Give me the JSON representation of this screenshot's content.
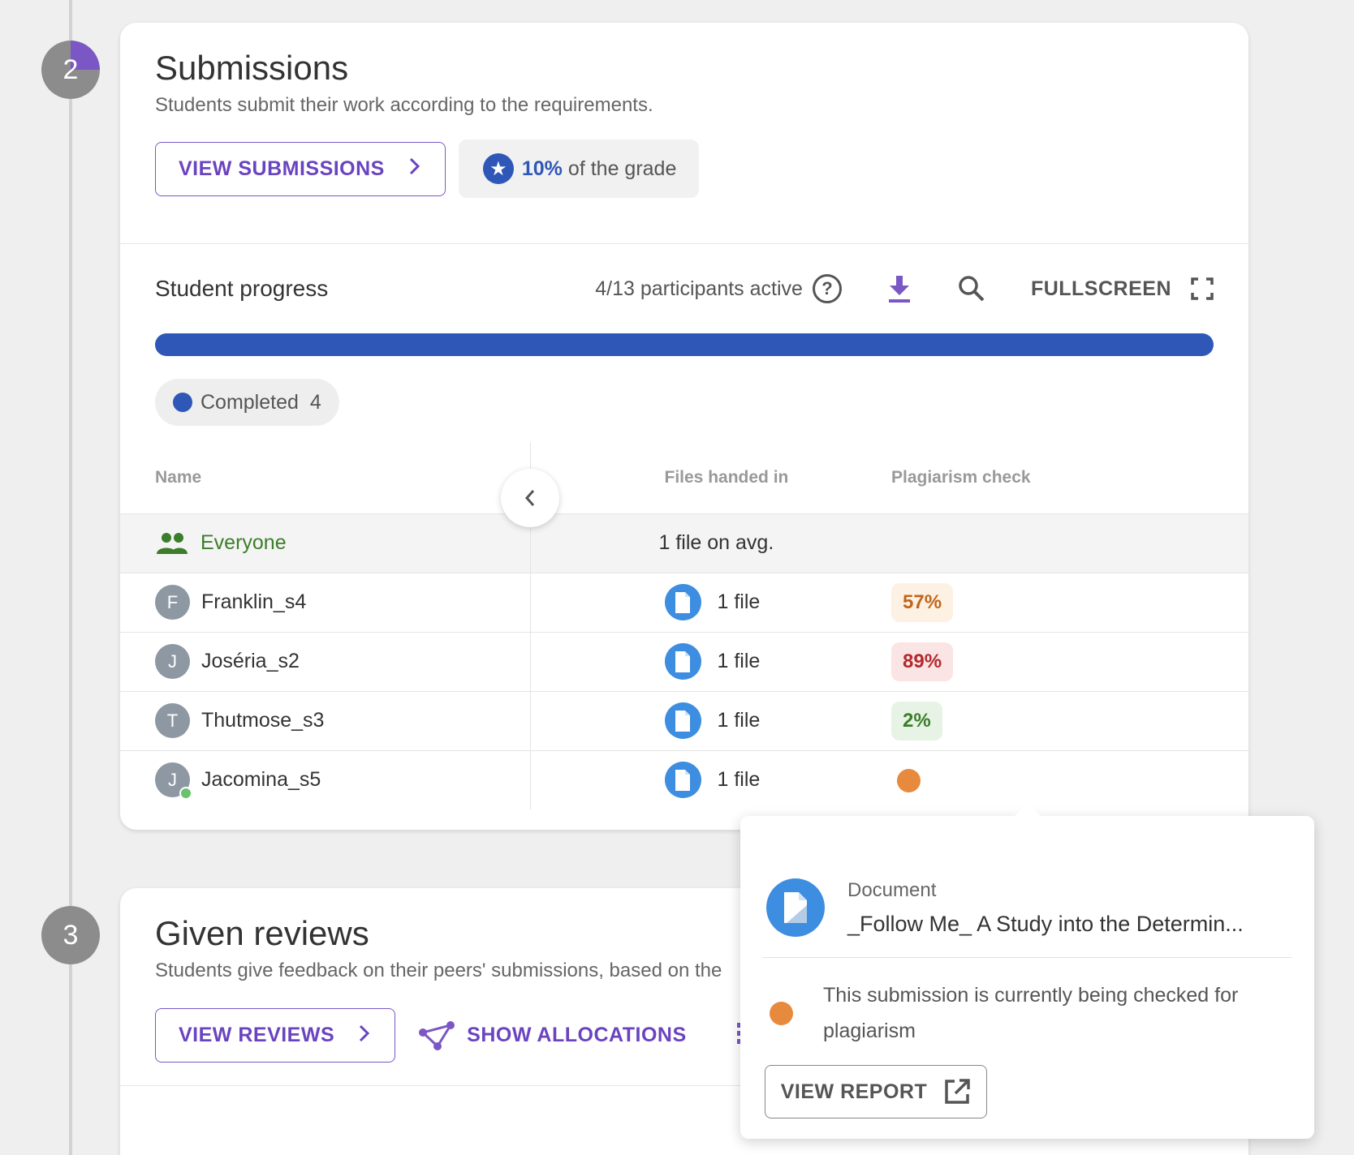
{
  "steps": [
    {
      "number": "2"
    },
    {
      "number": "3"
    }
  ],
  "submissions": {
    "title": "Submissions",
    "description": "Students submit their work according to the requirements.",
    "view_button": "VIEW SUBMISSIONS",
    "grade_percent": "10%",
    "grade_suffix": "of the grade"
  },
  "progress": {
    "title": "Student progress",
    "participants": "4/13 participants active",
    "fullscreen_label": "FULLSCREEN",
    "completed_fraction": 1.0,
    "bar_color": "#2f57b8",
    "legend": {
      "label": "Completed",
      "count": "4"
    }
  },
  "table": {
    "columns": [
      "Name",
      "Files handed in",
      "Plagiarism check"
    ],
    "everyone": {
      "label": "Everyone",
      "files": "1 file on avg."
    },
    "rows": [
      {
        "initial": "F",
        "name": "Franklin_s4",
        "files": "1 file",
        "plagiarism": "57%",
        "level": "warn",
        "online": false
      },
      {
        "initial": "J",
        "name": "Joséria_s2",
        "files": "1 file",
        "plagiarism": "89%",
        "level": "bad",
        "online": false
      },
      {
        "initial": "T",
        "name": "Thutmose_s3",
        "files": "1 file",
        "plagiarism": "2%",
        "level": "good",
        "online": false
      },
      {
        "initial": "J",
        "name": "Jacomina_s5",
        "files": "1 file",
        "plagiarism": "",
        "level": "pending",
        "online": true
      }
    ]
  },
  "reviews": {
    "title": "Given reviews",
    "description": "Students give feedback on their peers' submissions, based on the",
    "view_button": "VIEW REVIEWS",
    "allocations_button": "SHOW ALLOCATIONS"
  },
  "popover": {
    "doc_label": "Document",
    "doc_title": "_Follow Me_ A Study into the Determin...",
    "message": "This submission is currently being checked for plagiarism",
    "button": "VIEW REPORT"
  },
  "colors": {
    "accent": "#7b57c5",
    "primary": "#2f57b8",
    "pending": "#e88a3e"
  }
}
